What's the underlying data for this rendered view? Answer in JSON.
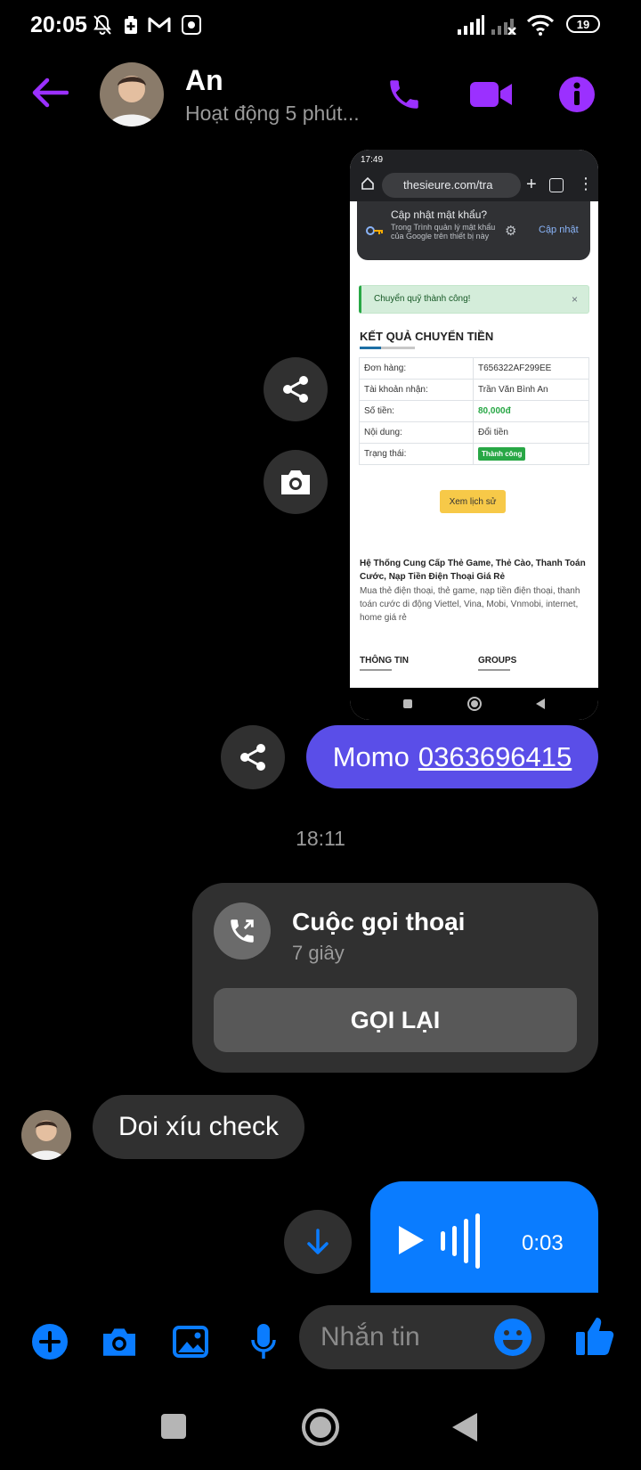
{
  "status_bar": {
    "time": "20:05",
    "battery": "19"
  },
  "header": {
    "contact_name": "An",
    "contact_status": "Hoạt động 5 phút...",
    "colors": {
      "accent": "#9b30ff"
    }
  },
  "shared_screenshot": {
    "time": "17:49",
    "url": "thesieure.com/tra",
    "popup_title": "Cập nhật mật khẩu?",
    "popup_desc": "Trong Trình quản lý mật khẩu của Google trên thiết bị này",
    "popup_button": "Cập nhật",
    "alert_text": "Chuyển quỹ thành công!",
    "alert_close": "×",
    "heading": "KẾT QUẢ CHUYỂN TIỀN",
    "rows": [
      {
        "label": "Đơn hàng:",
        "value": "T656322AF299EE"
      },
      {
        "label": "Tài khoản nhận:",
        "value": "Trần Văn Bình An"
      },
      {
        "label": "Số tiền:",
        "value": "80,000đ"
      },
      {
        "label": "Nội dung:",
        "value": "Đổi tiền"
      },
      {
        "label": "Trạng thái:",
        "value": "Thành công"
      }
    ],
    "history_button": "Xem lịch sử",
    "desc_title": "Hệ Thống Cung Cấp Thẻ Game, Thẻ Cào, Thanh Toán Cước, Nạp Tiền Điện Thoại Giá Rẻ",
    "desc_body": "Mua thẻ điện thoại, thẻ game, nạp tiền điện thoại, thanh toán cước di động Viettel, Vina, Mobi, Vnmobi, internet, home giá rẻ",
    "footer_left": "THÔNG TIN",
    "footer_right": "GROUPS"
  },
  "messages": {
    "momo_prefix": "Momo",
    "momo_phone": "0363696415",
    "timestamp": "18:11",
    "call_title": "Cuộc gọi thoại",
    "call_duration": "7 giây",
    "callback_label": "GỌI LẠI",
    "incoming_text": "Doi xíu check",
    "voice_duration": "0:03"
  },
  "composer": {
    "placeholder": "Nhắn tin"
  },
  "colors": {
    "messenger_blue": "#0a7cff",
    "momo_bubble": "#5a4ee8",
    "bubble_gray": "#303030"
  }
}
